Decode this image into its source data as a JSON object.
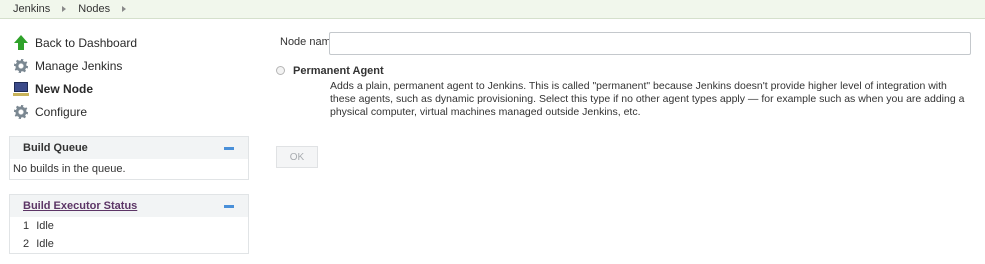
{
  "breadcrumb": [
    "Jenkins",
    "Nodes"
  ],
  "tasks": [
    {
      "label": "Back to Dashboard",
      "icon": "up-arrow-icon"
    },
    {
      "label": "Manage Jenkins",
      "icon": "gear-icon"
    },
    {
      "label": "New Node",
      "icon": "computer-icon"
    },
    {
      "label": "Configure",
      "icon": "gear-icon"
    }
  ],
  "build_queue": {
    "title": "Build Queue",
    "empty_text": "No builds in the queue."
  },
  "executor_status": {
    "title": "Build Executor Status",
    "executors": [
      {
        "num": "1",
        "state": "Idle"
      },
      {
        "num": "2",
        "state": "Idle"
      }
    ]
  },
  "form": {
    "node_name_label": "Node name",
    "node_name_value": "",
    "option_label": "Permanent Agent",
    "option_description": "Adds a plain, permanent agent to Jenkins. This is called \"permanent\" because Jenkins doesn't provide higher level of integration with these agents, such as dynamic provisioning. Select this type if no other agent types apply — for example such as when you are adding a physical computer, virtual machines managed outside Jenkins, etc.",
    "ok_label": "OK"
  },
  "colors": {
    "breadcrumb_bg": "#f1f7ec",
    "accent_blue": "#4a90d9",
    "link_purple": "#5c3566"
  }
}
